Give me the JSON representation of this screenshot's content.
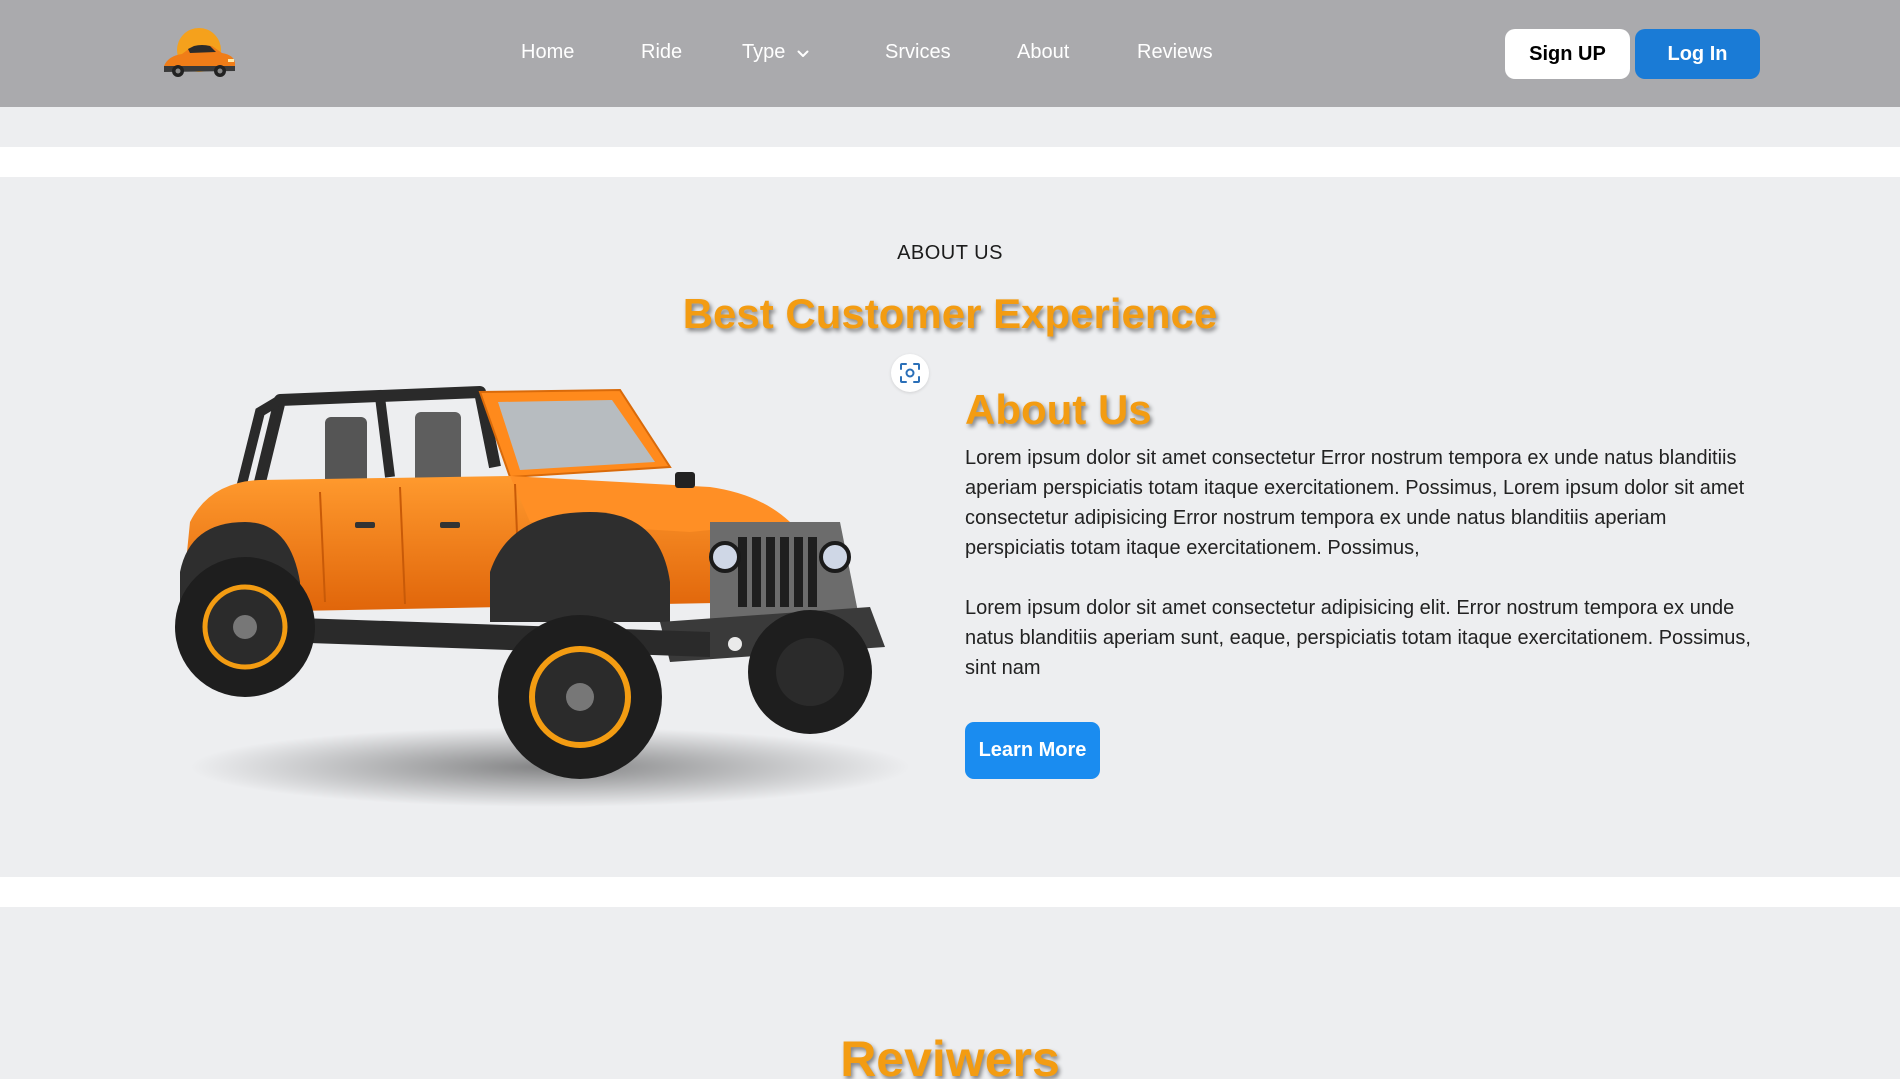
{
  "nav": {
    "links": [
      {
        "label": "Home"
      },
      {
        "label": "Ride"
      },
      {
        "label": "Type"
      },
      {
        "label": "Srvices"
      },
      {
        "label": "About"
      },
      {
        "label": "Reviews"
      }
    ],
    "signup_label": "Sign UP",
    "login_label": "Log In"
  },
  "about": {
    "kicker": "ABOUT US",
    "headline": "Best Customer Experience",
    "title": "About Us",
    "paragraphs": [
      "Lorem ipsum dolor sit amet consectetur Error nostrum tempora ex unde natus blanditiis aperiam perspiciatis totam itaque exercitationem. Possimus, Lorem ipsum dolor sit amet consectetur adipisicing Error nostrum tempora ex unde natus blanditiis aperiam perspiciatis totam itaque exercitationem. Possimus,",
      "Lorem ipsum dolor sit amet consectetur adipisicing elit. Error nostrum tempora ex unde natus blanditiis aperiam sunt, eaque, perspiciatis totam itaque exercitationem. Possimus, sint nam"
    ],
    "learn_more_label": "Learn More"
  },
  "reviews": {
    "title": "Reviwers"
  },
  "colors": {
    "navbar": "#aaaaad",
    "accent": "#f39c12",
    "login": "#1a7bd6",
    "learn_more": "#1a8cf0",
    "page_bg": "#edeef0"
  },
  "icons": {
    "logo": "car-logo-icon",
    "type_dropdown": "chevron-down-icon",
    "scan": "scan-icon"
  }
}
